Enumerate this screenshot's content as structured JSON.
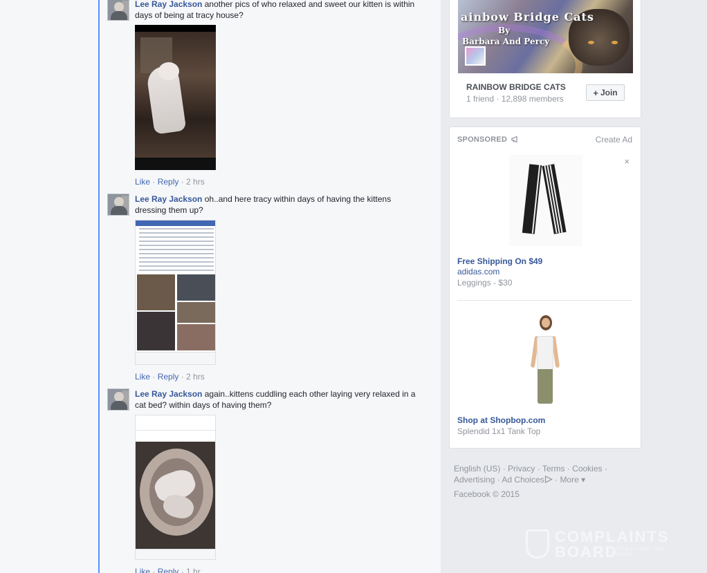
{
  "comments": [
    {
      "author": "Lee Ray Jackson",
      "text": " another pics of who relaxed and sweet our kitten is within days of being at tracy house?",
      "like": "Like",
      "reply": "Reply",
      "time": "2 hrs"
    },
    {
      "author": "Lee Ray Jackson",
      "text": " oh..and here tracy within days of having the kittens dressing them up?",
      "like": "Like",
      "reply": "Reply",
      "time": "2 hrs"
    },
    {
      "author": "Lee Ray Jackson",
      "text": " again..kittens cuddling each other laying very relaxed in a cat bed? within days of having them?",
      "like": "Like",
      "reply": "Reply",
      "time": "1 hr"
    }
  ],
  "group": {
    "cover_line1": "ainbow Bridge Cats",
    "cover_line2": "By",
    "cover_line3": "Barbara And Percy",
    "name": "RAINBOW BRIDGE CATS",
    "meta": "1 friend · 12,898 members",
    "join_label": "Join"
  },
  "sponsored": {
    "label": "SPONSORED",
    "create_ad": "Create Ad",
    "close": "×",
    "ads": [
      {
        "title": "Free Shipping On $49",
        "domain": "adidas.com",
        "sub": "Leggings - $30"
      },
      {
        "title": "Shop at Shopbop.com",
        "domain": "",
        "sub": "Splendid 1x1 Tank Top"
      }
    ]
  },
  "footer": {
    "links": [
      "English (US)",
      "Privacy",
      "Terms",
      "Cookies",
      "Advertising",
      "Ad Choices",
      "More"
    ],
    "copyright": "Facebook © 2015"
  },
  "watermark": {
    "line1": "COMPLAINTS",
    "line2": "BOARD",
    "tagline": "RESOLVING ONE CASE"
  },
  "colors": {
    "link": "#365899",
    "muted": "#90949c",
    "accent_border": "#5890ff",
    "page_bg": "#e9ebee"
  }
}
